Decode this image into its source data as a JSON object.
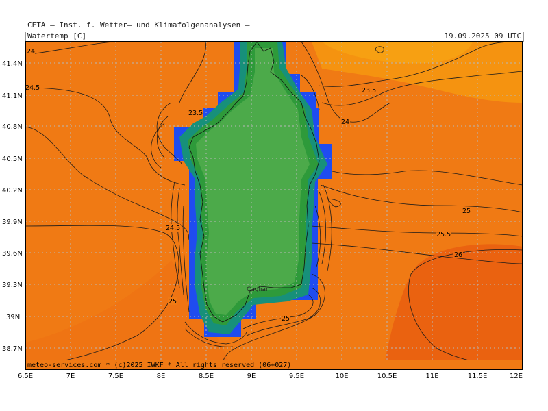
{
  "header": {
    "title": "CETA – Inst. f. Wetter– und Klimafolgenanalysen –",
    "variable": "Watertemp_[C]",
    "datetime": "19.09.2025 09 UTC"
  },
  "map": {
    "lat_ticks": [
      "41.4N",
      "41.1N",
      "40.8N",
      "40.5N",
      "40.2N",
      "39.9N",
      "39.6N",
      "39.3N",
      "39N",
      "38.7N"
    ],
    "lon_ticks": [
      "6.5E",
      "7E",
      "7.5E",
      "8E",
      "8.5E",
      "9E",
      "9.5E",
      "10E",
      "10.5E",
      "11E",
      "11.5E",
      "12E"
    ],
    "contour_labels": [
      "24",
      "24.5",
      "23.5",
      "24",
      "23.5",
      "24.5",
      "25",
      "25",
      "25",
      "25.5",
      "26"
    ],
    "place_label": "Cagliar",
    "footer": "meteo-services.com * (c)2025 IWKF * All rights reserved (06+027)",
    "colors": {
      "sea_warm": "#f07a14",
      "sea_cool": "#f7a012",
      "sea_hot": "#ea6210",
      "land": "#4caa4a",
      "land_edge": "#2e9a3a",
      "coast_teal": "#17907a",
      "coast_blue": "#1f4cf0"
    }
  }
}
